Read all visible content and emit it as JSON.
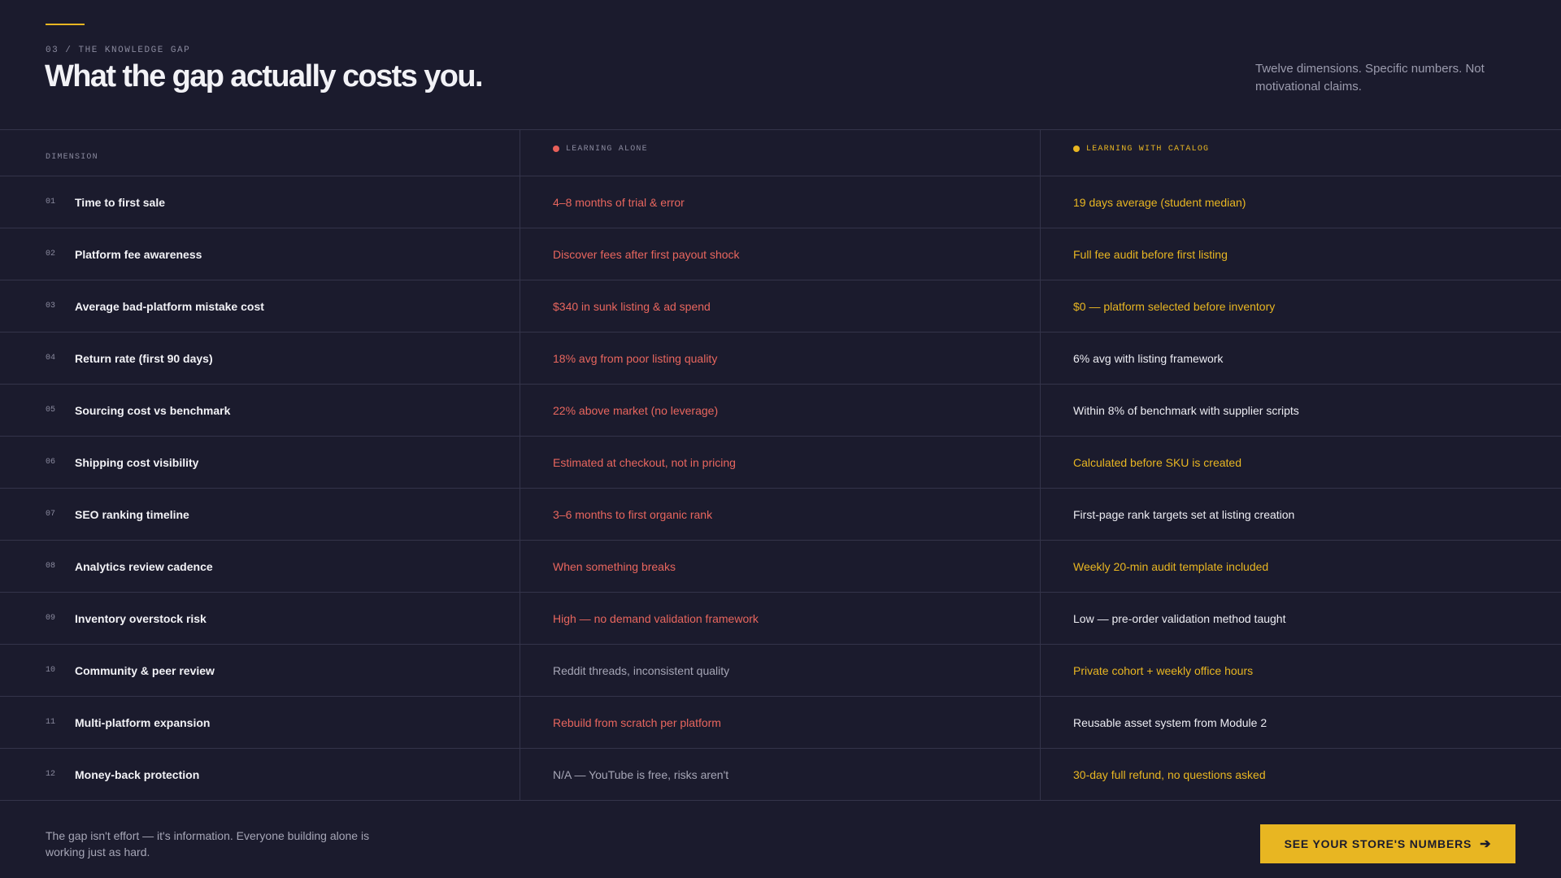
{
  "header": {
    "eyebrow": "03 / THE KNOWLEDGE GAP",
    "title": "What the gap actually costs you.",
    "subtitle": "Twelve dimensions. Specific numbers. Not motivational claims."
  },
  "table": {
    "columns": {
      "dimension": "DIMENSION",
      "alone": "LEARNING ALONE",
      "catalog": "LEARNING WITH CATALOG"
    },
    "rows": [
      {
        "num": "01",
        "label": "Time to first sale",
        "alone": "4–8 months of trial & error",
        "alone_tone": "red",
        "catalog": "19 days average (student median)",
        "catalog_tone": "yellow"
      },
      {
        "num": "02",
        "label": "Platform fee awareness",
        "alone": "Discover fees after first payout shock",
        "alone_tone": "red",
        "catalog": "Full fee audit before first listing",
        "catalog_tone": "yellow"
      },
      {
        "num": "03",
        "label": "Average bad-platform mistake cost",
        "alone": "$340 in sunk listing & ad spend",
        "alone_tone": "red",
        "catalog": "$0 — platform selected before inventory",
        "catalog_tone": "yellow"
      },
      {
        "num": "04",
        "label": "Return rate (first 90 days)",
        "alone": "18% avg from poor listing quality",
        "alone_tone": "red",
        "catalog": "6% avg with listing framework",
        "catalog_tone": "white"
      },
      {
        "num": "05",
        "label": "Sourcing cost vs benchmark",
        "alone": "22% above market (no leverage)",
        "alone_tone": "red",
        "catalog": "Within 8% of benchmark with supplier scripts",
        "catalog_tone": "white"
      },
      {
        "num": "06",
        "label": "Shipping cost visibility",
        "alone": "Estimated at checkout, not in pricing",
        "alone_tone": "red",
        "catalog": "Calculated before SKU is created",
        "catalog_tone": "yellow"
      },
      {
        "num": "07",
        "label": "SEO ranking timeline",
        "alone": "3–6 months to first organic rank",
        "alone_tone": "red",
        "catalog": "First-page rank targets set at listing creation",
        "catalog_tone": "white"
      },
      {
        "num": "08",
        "label": "Analytics review cadence",
        "alone": "When something breaks",
        "alone_tone": "red",
        "catalog": "Weekly 20-min audit template included",
        "catalog_tone": "yellow"
      },
      {
        "num": "09",
        "label": "Inventory overstock risk",
        "alone": "High — no demand validation framework",
        "alone_tone": "red",
        "catalog": "Low — pre-order validation method taught",
        "catalog_tone": "white"
      },
      {
        "num": "10",
        "label": "Community & peer review",
        "alone": "Reddit threads, inconsistent quality",
        "alone_tone": "gray",
        "catalog": "Private cohort + weekly office hours",
        "catalog_tone": "yellow"
      },
      {
        "num": "11",
        "label": "Multi-platform expansion",
        "alone": "Rebuild from scratch per platform",
        "alone_tone": "red",
        "catalog": "Reusable asset system from Module 2",
        "catalog_tone": "white"
      },
      {
        "num": "12",
        "label": "Money-back protection",
        "alone": "N/A — YouTube is free, risks aren't",
        "alone_tone": "gray",
        "catalog": "30-day full refund, no questions asked",
        "catalog_tone": "yellow"
      }
    ]
  },
  "footer": {
    "text": "The gap isn't effort — it's information. Everyone building alone is working just as hard.",
    "cta_label": "SEE YOUR STORE'S NUMBERS",
    "cta_icon": "arrow-right-icon"
  },
  "colors": {
    "background": "#1b1b2d",
    "accent": "#e8b622",
    "negative": "#e8665e"
  }
}
